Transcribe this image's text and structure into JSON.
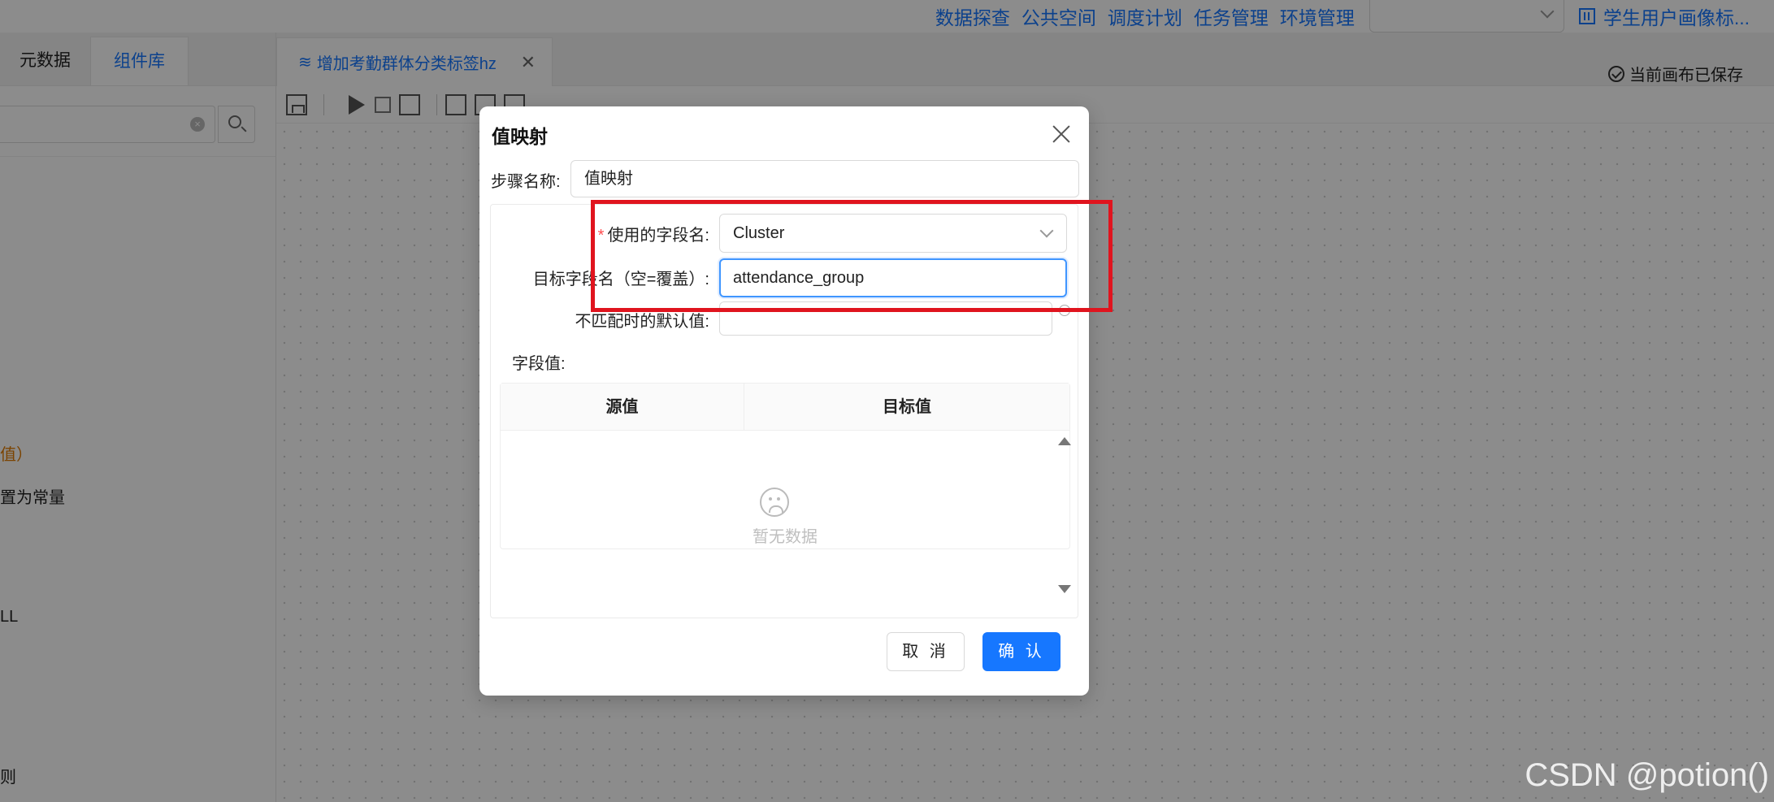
{
  "topnav": {
    "links": [
      "数据探查",
      "公共空间",
      "调度计划",
      "任务管理",
      "环境管理"
    ],
    "project_title": "学生用户画像标..."
  },
  "left_panel": {
    "tabs": [
      "元数据",
      "组件库"
    ],
    "fragments": [
      "值）",
      "置为常量",
      "LL",
      "则"
    ]
  },
  "editor": {
    "tab_title": "增加考勤群体分类标签hz",
    "saved_status": "当前画布已保存"
  },
  "modal": {
    "title": "值映射",
    "step_name_label": "步骤名称:",
    "step_name_value": "值映射",
    "field_name_label": "使用的字段名:",
    "field_name_value": "Cluster",
    "target_field_label": "目标字段名（空=覆盖）:",
    "target_field_value": "attendance_group",
    "default_value_label": "不匹配时的默认值:",
    "field_values_label": "字段值:",
    "table": {
      "columns": [
        "源值",
        "目标值"
      ],
      "empty_text": "暂无数据"
    },
    "cancel_label": "取 消",
    "confirm_label": "确 认"
  },
  "watermark": "CSDN @potion()",
  "colors": {
    "primary": "#1677ff",
    "highlight": "#e0141e",
    "required": "#ff4d4f"
  }
}
